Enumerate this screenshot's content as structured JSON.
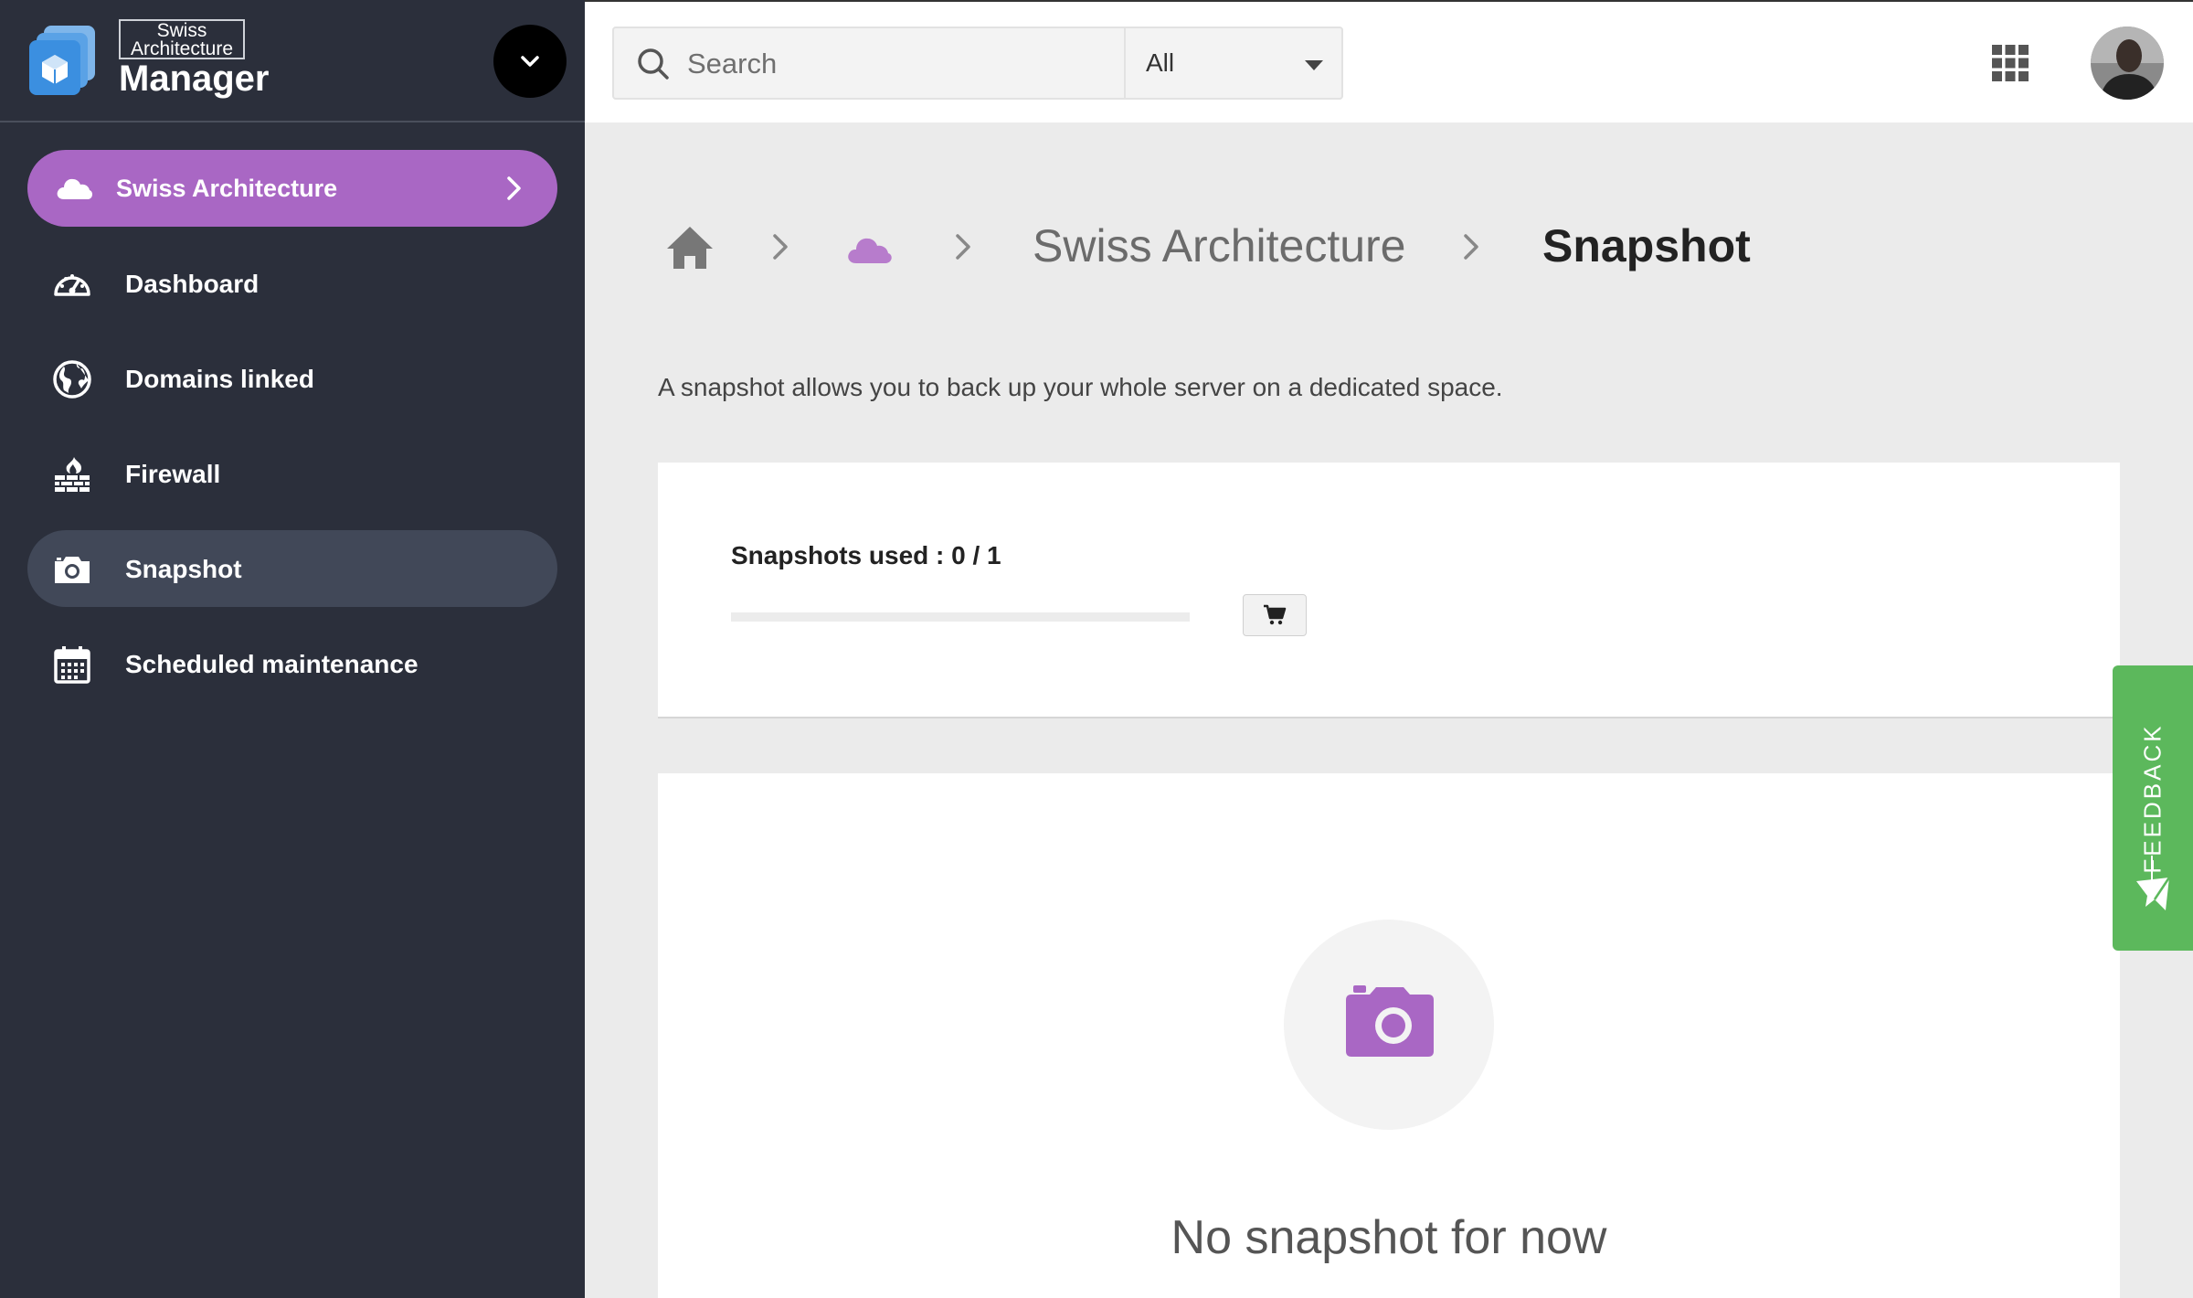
{
  "brand": {
    "small_text": "Swiss Architecture",
    "title": "Manager"
  },
  "sidebar": {
    "project": {
      "label": "Swiss Architecture",
      "icon": "cloud-icon"
    },
    "items": [
      {
        "label": "Dashboard",
        "icon": "gauge-icon",
        "active": false
      },
      {
        "label": "Domains linked",
        "icon": "globe-icon",
        "active": false
      },
      {
        "label": "Firewall",
        "icon": "firewall-icon",
        "active": false
      },
      {
        "label": "Snapshot",
        "icon": "camera-icon",
        "active": true
      },
      {
        "label": "Scheduled maintenance",
        "icon": "calendar-icon",
        "active": false
      }
    ]
  },
  "topbar": {
    "search": {
      "placeholder": "Search",
      "value": ""
    },
    "filter": {
      "selected": "All"
    }
  },
  "breadcrumb": {
    "project": "Swiss Architecture",
    "current": "Snapshot"
  },
  "intro_text": "A snapshot allows you to back up your whole server on a dedicated space.",
  "usage": {
    "label": "Snapshots used : 0 / 1",
    "used": 0,
    "total": 1
  },
  "empty_state": {
    "message": "No snapshot for now"
  },
  "feedback": {
    "label": "FEEDBACK"
  },
  "colors": {
    "sidebar_bg": "#2b2f3b",
    "accent_purple": "#a967c4",
    "active_item_bg": "#414858",
    "feedback_green": "#5cb85c",
    "page_bg": "#ebebeb"
  }
}
